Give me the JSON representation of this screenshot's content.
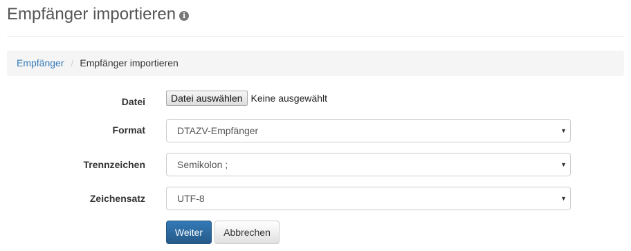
{
  "page": {
    "title": "Empfänger importieren",
    "info_icon": "info-icon"
  },
  "breadcrumb": {
    "items": [
      {
        "label": "Empfänger"
      },
      {
        "label": "Empfänger importieren"
      }
    ],
    "separator": "/"
  },
  "form": {
    "file": {
      "label": "Datei",
      "button_label": "Datei auswählen",
      "status": "Keine ausgewählt"
    },
    "format": {
      "label": "Format",
      "value": "DTAZV-Empfänger"
    },
    "delimiter": {
      "label": "Trennzeichen",
      "value": "Semikolon ;"
    },
    "charset": {
      "label": "Zeichensatz",
      "value": "UTF-8"
    },
    "select_caret": "▼"
  },
  "actions": {
    "submit_label": "Weiter",
    "cancel_label": "Abbrechen"
  },
  "colors": {
    "primary": "#337ab7",
    "link": "#337ab7",
    "breadcrumb_bg": "#f5f5f5"
  }
}
